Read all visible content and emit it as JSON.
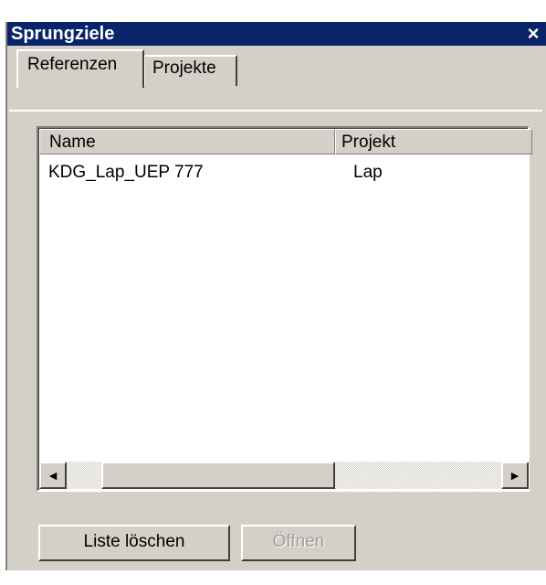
{
  "window": {
    "title": "Sprungziele",
    "close_glyph": "×"
  },
  "tabs": [
    {
      "label": "Referenzen",
      "active": true
    },
    {
      "label": "Projekte",
      "active": false
    }
  ],
  "list": {
    "columns": [
      "Name",
      "Projekt"
    ],
    "rows": [
      {
        "name": "KDG_Lap_UEP 777",
        "projekt": "Lap"
      }
    ]
  },
  "scrollbar": {
    "left_arrow": "◄",
    "right_arrow": "►"
  },
  "buttons": {
    "clear_label": "Liste löschen",
    "open_label": "Öffnen"
  },
  "colors": {
    "titlebar": "#0a246a",
    "face": "#d4d0c8"
  }
}
